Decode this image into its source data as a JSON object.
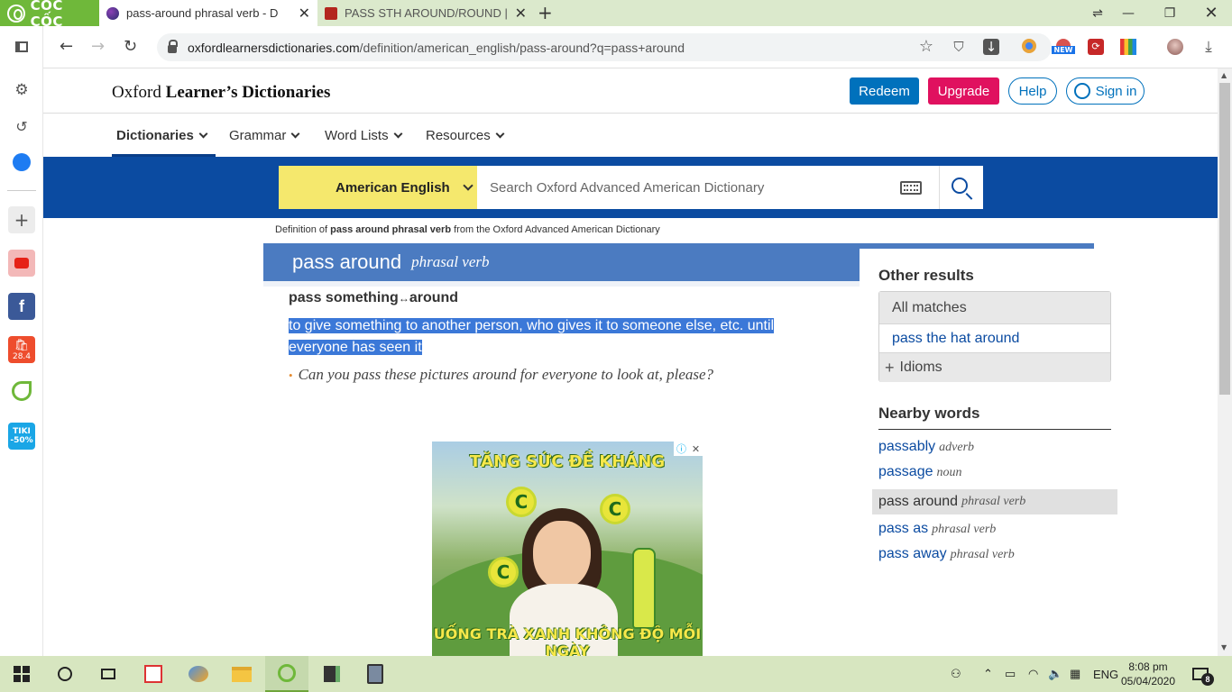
{
  "browser": {
    "brand": "CỐC CỐC",
    "tabs": [
      {
        "title": "pass-around phrasal verb - D",
        "active": true
      },
      {
        "title": "PASS STH AROUND/ROUND |",
        "active": false
      }
    ],
    "url_domain": "oxfordlearnersdictionaries.com",
    "url_path": "/definition/american_english/pass-around?q=pass+around",
    "new_badge": "NEW"
  },
  "sidebar": {
    "tiki_label_top": "TIKI",
    "tiki_label_bottom": "-50%",
    "shopee_label": "28.4"
  },
  "header": {
    "logo_regular": "Oxford ",
    "logo_bold": "Learner’s Dictionaries",
    "redeem": "Redeem",
    "upgrade": "Upgrade",
    "help": "Help",
    "sign_in": "Sign in"
  },
  "menu": {
    "items": [
      "Dictionaries",
      "Grammar",
      "Word Lists",
      "Resources"
    ]
  },
  "search": {
    "dictionary": "American English",
    "placeholder": "Search Oxford Advanced American Dictionary"
  },
  "entry": {
    "source_prefix": "Definition of ",
    "source_term": "pass around phrasal verb",
    "source_suffix": " from the Oxford Advanced American Dictionary",
    "headword": "pass around",
    "pos": "phrasal verb",
    "form_a": "pass something",
    "form_arrow": "↔",
    "form_b": "around",
    "definition": "to give something to another person, who gives it to someone else, etc. until everyone has seen it",
    "example": "Can you pass these pictures around for everyone to look at, please?"
  },
  "ad": {
    "headline": "TĂNG SỨC ĐỀ KHÁNG",
    "bottom": "UỐNG TRÀ XANH KHÔNG ĐỘ MỖI NGÀY",
    "vitamin_letter": "C"
  },
  "sidebar_results": {
    "other_results_title": "Other results",
    "all_matches": "All matches",
    "match_item": "pass the hat around",
    "idioms": "Idioms",
    "nearby_title": "Nearby words",
    "nearby": [
      {
        "word": "passably",
        "pos": "adverb"
      },
      {
        "word": "passage",
        "pos": "noun"
      },
      {
        "word": "pass around",
        "pos": "phrasal verb"
      },
      {
        "word": "pass as",
        "pos": "phrasal verb"
      },
      {
        "word": "pass away",
        "pos": "phrasal verb"
      }
    ]
  },
  "taskbar": {
    "lang": "ENG",
    "time": "8:08 pm",
    "date": "05/04/2020",
    "notif_count": "8"
  }
}
